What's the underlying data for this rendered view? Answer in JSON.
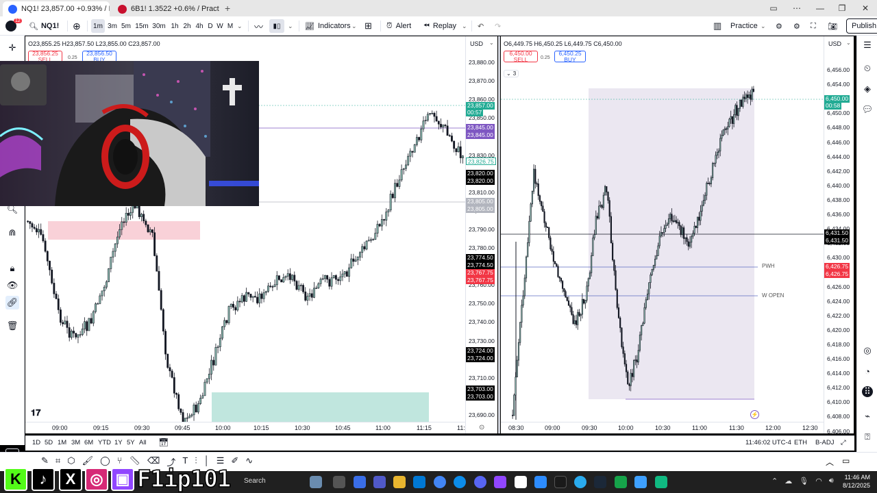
{
  "browser": {
    "tabs": [
      {
        "label": "NQ1! 23,857.00 +0.93% / I...",
        "active": true
      },
      {
        "label": "6B1! 1.3522 +0.6% / Practic...",
        "active": false
      }
    ],
    "new_tab": "+"
  },
  "toolbar": {
    "symbol": "NQ1!",
    "timeframes": [
      "1m",
      "3m",
      "5m",
      "15m",
      "30m",
      "1h",
      "2h",
      "4h",
      "D",
      "W",
      "M"
    ],
    "selected_timeframe": "1m",
    "indicators": "Indicators",
    "alert": "Alert",
    "replay": "Replay",
    "practice": "Practice",
    "publish": "Publish",
    "notif_count": "12"
  },
  "chart_left": {
    "ohlc": "O23,855.25  H23,857.50  L23,855.00  C23,857.00",
    "sell_price": "23,856.25",
    "sell_label": "SELL",
    "spread": "0.25",
    "buy_price": "23,856.50",
    "buy_label": "BUY",
    "currency": "USD",
    "price_labels": [
      "23,880.00",
      "23,870.00",
      "23,860.00",
      "23,850.00",
      "23,840.00",
      "23,830.00",
      "23,820.00",
      "23,810.00",
      "23,800.00",
      "23,790.00",
      "23,780.00",
      "23,770.00",
      "23,760.00",
      "23,750.00",
      "23,740.00",
      "23,730.00",
      "23,720.00",
      "23,710.00",
      "23,700.00",
      "23,690.00"
    ],
    "tags": [
      {
        "text": "23,857.00",
        "color": "#22ab94"
      },
      {
        "text": "00:57",
        "color": "#22ab94"
      },
      {
        "text": "23,845.00",
        "color": "#7e57c2"
      },
      {
        "text": "23,845.00",
        "color": "#7e57c2"
      },
      {
        "text": "23,826.75",
        "color": "#ffffff"
      },
      {
        "text": "23,820.00",
        "color": "#000000"
      },
      {
        "text": "23,820.00",
        "color": "#000000"
      },
      {
        "text": "23,805.00",
        "color": "#b2b5be"
      },
      {
        "text": "23,805.00",
        "color": "#b2b5be"
      },
      {
        "text": "23,774.50",
        "color": "#000000"
      },
      {
        "text": "23,774.50",
        "color": "#000000"
      },
      {
        "text": "23,767.75",
        "color": "#f23645"
      },
      {
        "text": "23,767.75",
        "color": "#f23645"
      },
      {
        "text": "23,724.00",
        "color": "#000000"
      },
      {
        "text": "23,724.00",
        "color": "#000000"
      },
      {
        "text": "23,703.00",
        "color": "#000000"
      },
      {
        "text": "23,703.00",
        "color": "#000000"
      }
    ],
    "time_labels": [
      "09:00",
      "09:15",
      "09:30",
      "09:45",
      "10:00",
      "10:15",
      "10:30",
      "10:45",
      "11:00",
      "11:15",
      "11:"
    ]
  },
  "chart_right": {
    "ohlc": "O6,449.75  H6,450.25  L6,449.75  C6,450.00",
    "sell_price": "6,450.00",
    "sell_label": "SELL",
    "spread": "0.25",
    "buy_price": "6,450.25",
    "buy_label": "BUY",
    "collapse_count": "3",
    "currency": "USD",
    "price_labels": [
      "6,456.00",
      "6,454.00",
      "6,452.00",
      "6,450.00",
      "6,448.00",
      "6,446.00",
      "6,444.00",
      "6,442.00",
      "6,440.00",
      "6,438.00",
      "6,436.00",
      "6,434.00",
      "6,432.00",
      "6,430.00",
      "6,428.00",
      "6,426.00",
      "6,424.00",
      "6,422.00",
      "6,420.00",
      "6,418.00",
      "6,416.00",
      "6,414.00",
      "6,412.00",
      "6,410.00",
      "6,408.00",
      "6,406.00"
    ],
    "tags": [
      {
        "text": "6,450.00",
        "color": "#22ab94"
      },
      {
        "text": "00:58",
        "color": "#22ab94"
      },
      {
        "text": "6,431.50",
        "color": "#000000"
      },
      {
        "text": "6,431.50",
        "color": "#000000"
      },
      {
        "text": "6,426.75",
        "color": "#f23645"
      },
      {
        "text": "6,426.75",
        "color": "#f23645"
      }
    ],
    "level_pwh": "PWH",
    "level_wopen": "W OPEN",
    "time_labels": [
      "08:30",
      "09:00",
      "09:30",
      "10:00",
      "10:30",
      "11:00",
      "11:30",
      "12:00",
      "12:30"
    ]
  },
  "bottom": {
    "ranges": [
      "1D",
      "5D",
      "1M",
      "3M",
      "6M",
      "YTD",
      "1Y",
      "5Y",
      "All"
    ],
    "clock": "11:46:02 UTC-4",
    "session": "ETH",
    "adj": "B-ADJ"
  },
  "taskbar": {
    "search": "Search",
    "time": "11:46 AM",
    "date": "8/12/2025"
  },
  "brand": {
    "name": "F1ip101",
    "icons": [
      "K",
      "♪",
      "X",
      "◎",
      "▣"
    ]
  }
}
